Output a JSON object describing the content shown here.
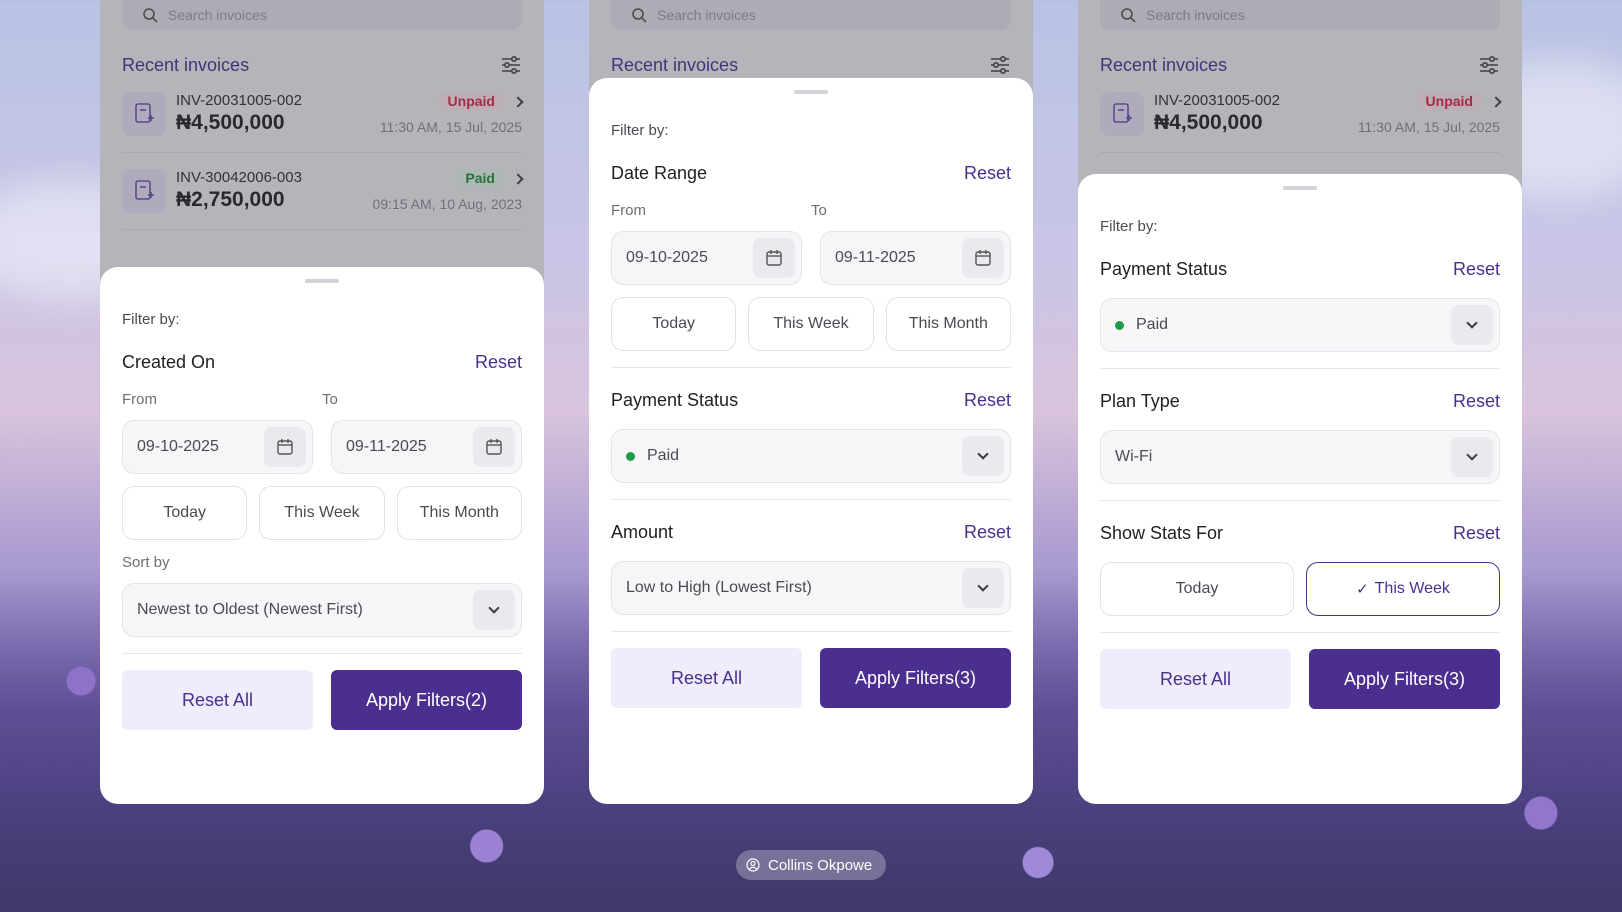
{
  "credit": {
    "author": "Collins Okpowe"
  },
  "background": {
    "search_placeholder": "Search invoices",
    "recent_title": "Recent invoices",
    "invoices": [
      {
        "id": "INV-20031005-002",
        "amount": "₦4,500,000",
        "status": "Unpaid",
        "time": "11:30 AM, 15 Jul, 2025"
      },
      {
        "id": "INV-30042006-003",
        "amount": "₦2,750,000",
        "status": "Paid",
        "time": "09:15 AM, 10 Aug, 2023"
      }
    ]
  },
  "panel1": {
    "filter_by": "Filter by:",
    "created_on": {
      "title": "Created On",
      "reset": "Reset",
      "from_label": "From",
      "to_label": "To",
      "from": "09-10-2025",
      "to": "09-11-2025"
    },
    "chips": [
      "Today",
      "This Week",
      "This Month"
    ],
    "sort_by": {
      "label": "Sort by",
      "value": "Newest to Oldest (Newest First)"
    },
    "reset_all": "Reset All",
    "apply": "Apply Filters(2)"
  },
  "panel2": {
    "filter_by": "Filter by:",
    "date_range": {
      "title": "Date Range",
      "reset": "Reset",
      "from_label": "From",
      "to_label": "To",
      "from": "09-10-2025",
      "to": "09-11-2025"
    },
    "chips": [
      "Today",
      "This Week",
      "This Month"
    ],
    "payment_status": {
      "title": "Payment Status",
      "reset": "Reset",
      "value": "Paid"
    },
    "amount": {
      "title": "Amount",
      "reset": "Reset",
      "value": "Low to High (Lowest First)"
    },
    "reset_all": "Reset All",
    "apply": "Apply Filters(3)"
  },
  "panel3": {
    "filter_by": "Filter by:",
    "payment_status": {
      "title": "Payment Status",
      "reset": "Reset",
      "value": "Paid"
    },
    "plan_type": {
      "title": "Plan Type",
      "reset": "Reset",
      "value": "Wi-Fi"
    },
    "show_stats": {
      "title": "Show Stats For",
      "reset": "Reset",
      "options": [
        "Today",
        "This Week"
      ],
      "selected": "This Week"
    },
    "reset_all": "Reset All",
    "apply": "Apply Filters(3)"
  },
  "colors": {
    "accent": "#4b2f8f",
    "paid": "#1f8a3a",
    "unpaid": "#d0264b"
  }
}
